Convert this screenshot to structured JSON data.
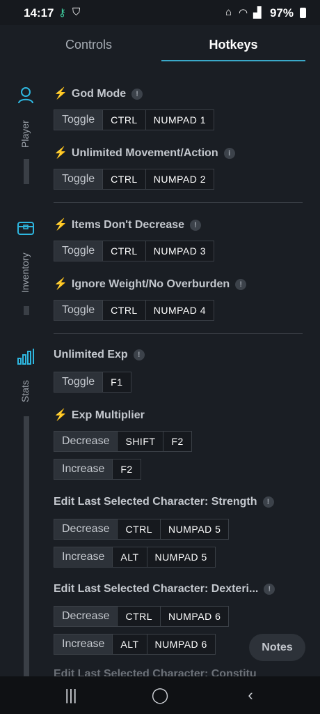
{
  "status": {
    "time": "14:17",
    "battery": "97%"
  },
  "tabs": {
    "controls": "Controls",
    "hotkeys": "Hotkeys"
  },
  "sidebar": {
    "player": "Player",
    "inventory": "Inventory",
    "stats": "Stats"
  },
  "sections": {
    "god_mode": {
      "title": "God Mode",
      "action": "Toggle",
      "k1": "CTRL",
      "k2": "NUMPAD 1"
    },
    "unlimited_movement": {
      "title": "Unlimited Movement/Action",
      "action": "Toggle",
      "k1": "CTRL",
      "k2": "NUMPAD 2"
    },
    "items_dont_decrease": {
      "title": "Items Don't Decrease",
      "action": "Toggle",
      "k1": "CTRL",
      "k2": "NUMPAD 3"
    },
    "ignore_weight": {
      "title": "Ignore Weight/No Overburden",
      "action": "Toggle",
      "k1": "CTRL",
      "k2": "NUMPAD 4"
    },
    "unlimited_exp": {
      "title": "Unlimited Exp",
      "action": "Toggle",
      "k1": "F1"
    },
    "exp_multiplier": {
      "title": "Exp Multiplier",
      "dec_action": "Decrease",
      "dec_k1": "SHIFT",
      "dec_k2": "F2",
      "inc_action": "Increase",
      "inc_k1": "F2"
    },
    "strength": {
      "title": "Edit Last Selected Character: Strength",
      "dec_action": "Decrease",
      "dec_k1": "CTRL",
      "dec_k2": "NUMPAD 5",
      "inc_action": "Increase",
      "inc_k1": "ALT",
      "inc_k2": "NUMPAD 5"
    },
    "dexterity": {
      "title": "Edit Last Selected Character: Dexteri...",
      "dec_action": "Decrease",
      "dec_k1": "CTRL",
      "dec_k2": "NUMPAD 6",
      "inc_action": "Increase",
      "inc_k1": "ALT",
      "inc_k2": "NUMPAD 6"
    },
    "next_cut": {
      "title": "Edit Last Selected Character: Constitu"
    }
  },
  "notes_label": "Notes",
  "icons": {
    "bolt": "bolt-icon",
    "info": "info-icon",
    "player": "person-icon",
    "inventory": "chest-icon",
    "stats": "bar-chart-icon"
  },
  "colors": {
    "accent": "#2eb7e0",
    "background": "#1a1e24"
  }
}
